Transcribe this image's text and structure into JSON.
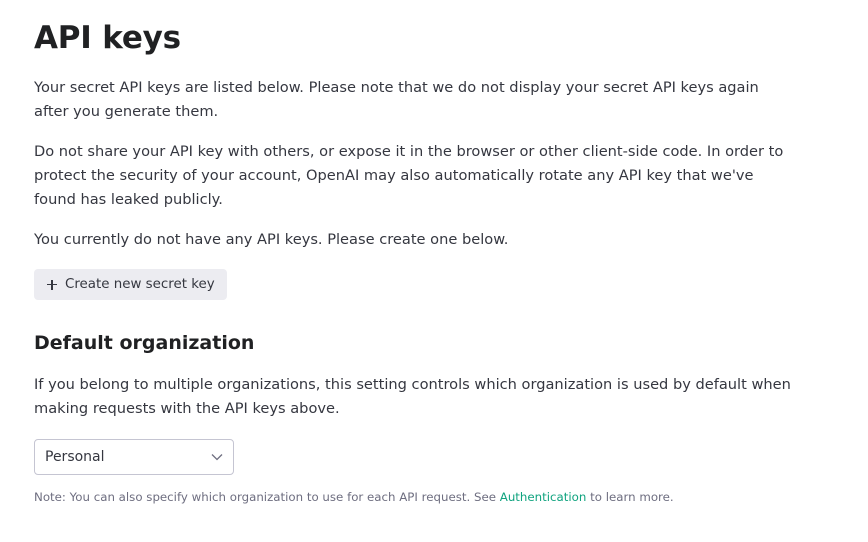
{
  "page": {
    "title": "API keys",
    "intro_1": "Your secret API keys are listed below. Please note that we do not display your secret API keys again after you generate them.",
    "intro_2": "Do not share your API key with others, or expose it in the browser or other client-side code. In order to protect the security of your account, OpenAI may also automatically rotate any API key that we've found has leaked publicly.",
    "empty_state": "You currently do not have any API keys. Please create one below.",
    "create_button_label": "Create new secret key"
  },
  "default_org": {
    "heading": "Default organization",
    "description": "If you belong to multiple organizations, this setting controls which organization is used by default when making requests with the API keys above.",
    "selected": "Personal",
    "note_before": "Note: You can also specify which organization to use for each API request. See ",
    "note_link": "Authentication",
    "note_after": " to learn more."
  },
  "colors": {
    "link": "#10a37f",
    "button_bg": "#ececf1",
    "text": "#353740",
    "heading": "#202123",
    "muted": "#6e6e80"
  }
}
